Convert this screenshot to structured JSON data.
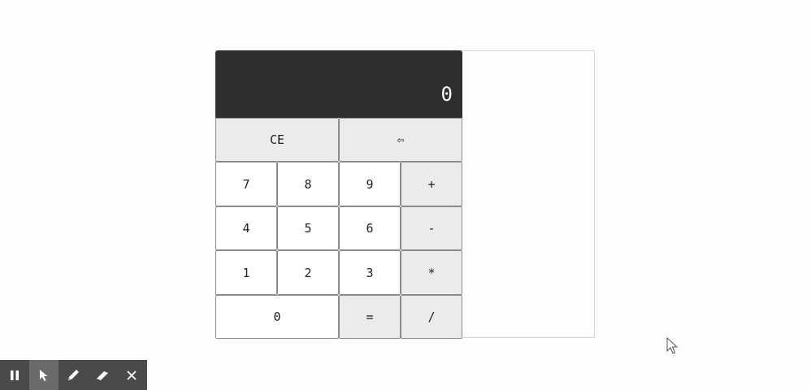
{
  "calculator": {
    "display_value": "0",
    "buttons": {
      "clear": "CE",
      "backspace": "⇦",
      "seven": "7",
      "eight": "8",
      "nine": "9",
      "plus": "+",
      "four": "4",
      "five": "5",
      "six": "6",
      "minus": "-",
      "one": "1",
      "two": "2",
      "three": "3",
      "multiply": "*",
      "zero": "0",
      "equals": "=",
      "divide": "/"
    }
  },
  "toolbar": {
    "tools": [
      "pause-icon",
      "pointer-icon",
      "pen-icon",
      "eraser-icon",
      "close-icon"
    ],
    "active_tool": "pointer-icon"
  },
  "colors": {
    "display_background": "#2f2f2f",
    "operator_background": "#ebebeb",
    "toolbar_background": "#4a4a4a"
  }
}
